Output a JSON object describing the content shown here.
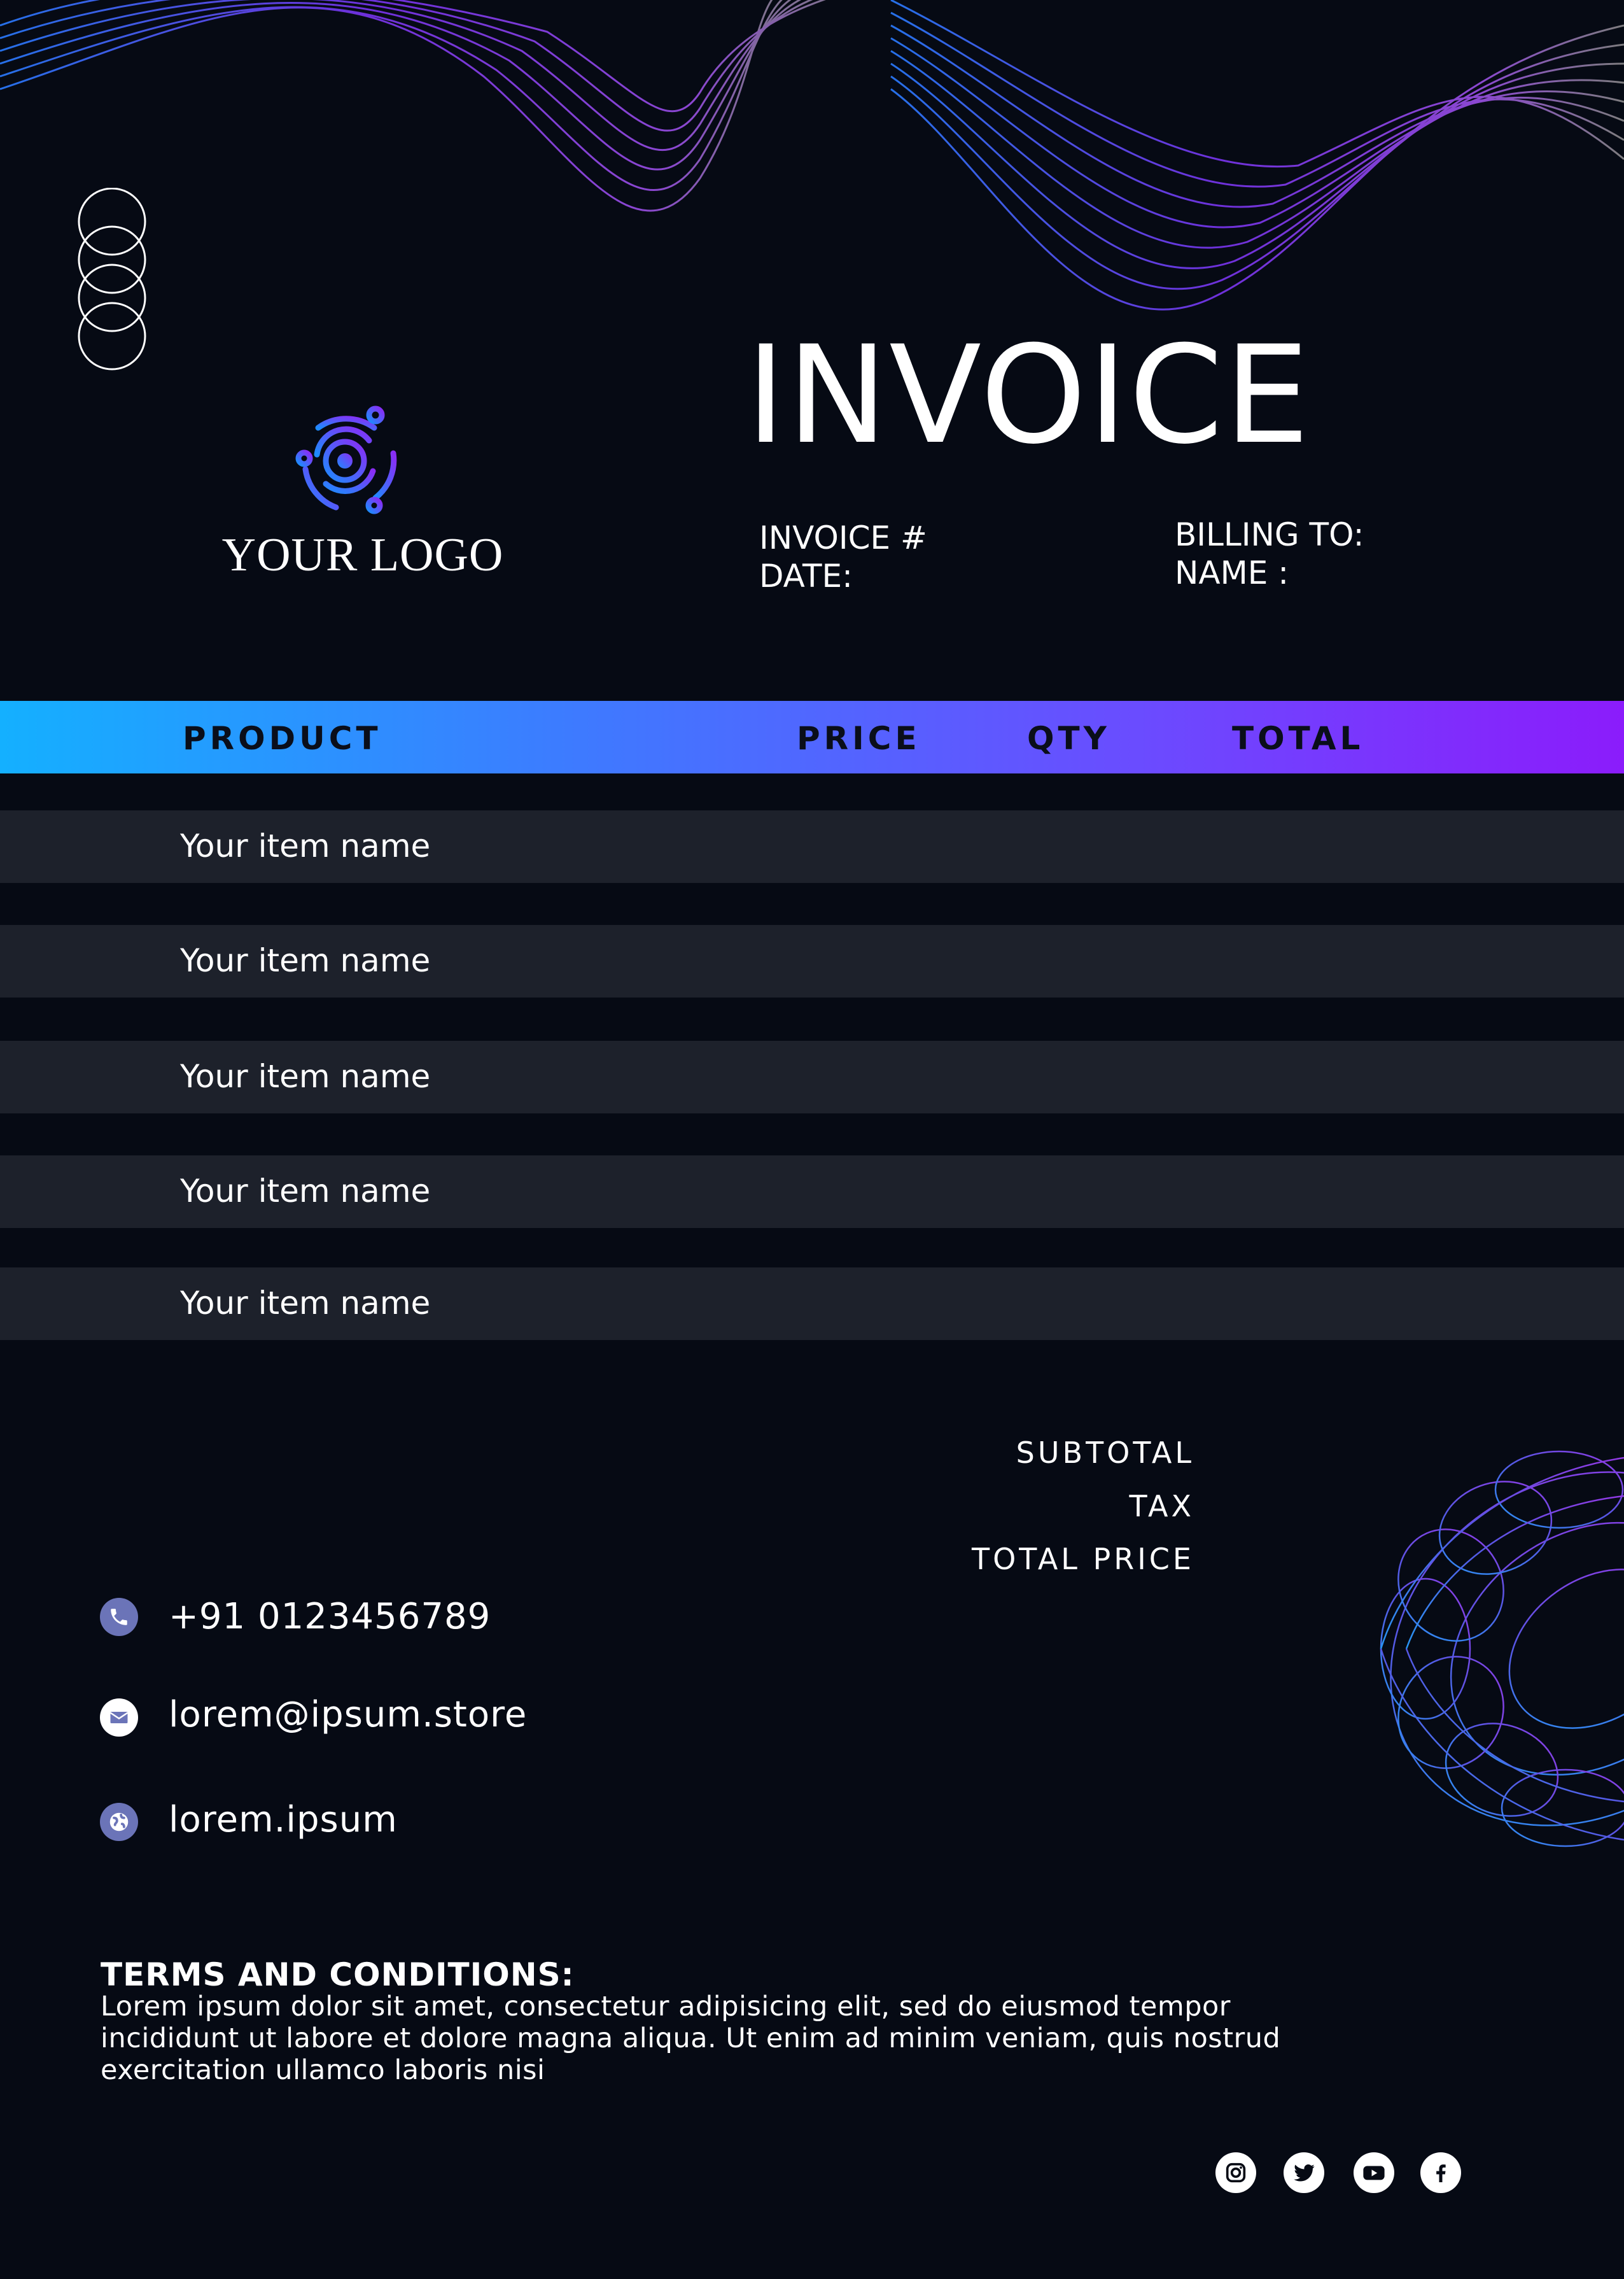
{
  "document": {
    "title": "INVOICE",
    "logo_text": "YOUR LOGO",
    "meta_left": [
      "INVOICE #",
      "DATE:"
    ],
    "meta_right": [
      "BILLING TO:",
      "NAME :"
    ]
  },
  "table": {
    "columns": [
      "PRODUCT",
      "PRICE",
      "QTY",
      "TOTAL"
    ],
    "rows": [
      "Your item name",
      "Your item name",
      "Your item name",
      "Your item name",
      "Your item name"
    ]
  },
  "summary": [
    "SUBTOTAL",
    "TAX",
    "TOTAL PRICE"
  ],
  "contact": {
    "phone": "+91 0123456789",
    "email": "lorem@ipsum.store",
    "website": "lorem.ipsum"
  },
  "terms": {
    "title": "TERMS AND CONDITIONS:",
    "lines": [
      "Lorem ipsum dolor sit amet, consectetur adipisicing elit, sed do eiusmod tempor",
      "incididunt ut labore et dolore magna aliqua. Ut enim ad minim veniam, quis nostrud",
      "exercitation ullamco laboris nisi"
    ]
  },
  "social_icons": [
    "instagram-icon",
    "twitter-icon",
    "youtube-icon",
    "facebook-icon"
  ],
  "colors": {
    "background": "#060a14",
    "row_background": "#1d212b",
    "gradient_start": "#14b0ff",
    "gradient_end": "#8b1cfb",
    "icon_circle": "#6b74b8"
  }
}
